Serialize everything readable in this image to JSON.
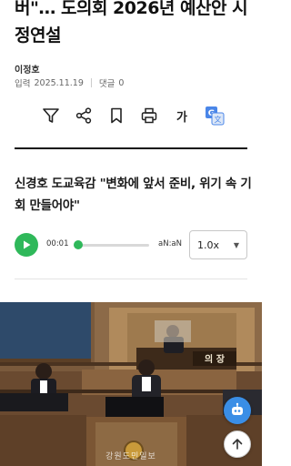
{
  "article": {
    "headline": "버\"… 도의회 2026년 예산안 시정연설",
    "author": "이정호",
    "date_label": "입력",
    "date": "2025.11.19",
    "comments_label": "댓글",
    "comments_count": "0",
    "font_size_label": "가",
    "subtitle": "신경호 도교육감 \"변화에 앞서 준비, 위기 속 기회 만들어야\"",
    "photo_watermark": "강원도민일보"
  },
  "toolbar": {
    "icons": [
      "filter-icon",
      "share-icon",
      "bookmark-icon",
      "print-icon",
      "font-size-icon",
      "translate-icon"
    ]
  },
  "player": {
    "current_time": "00:01",
    "duration": "aN:aN",
    "progress": 0.0,
    "speed": "1.0x"
  },
  "colors": {
    "accent": "#2fb85a",
    "fab_ai": "#3a8ee6",
    "text": "#111111"
  }
}
